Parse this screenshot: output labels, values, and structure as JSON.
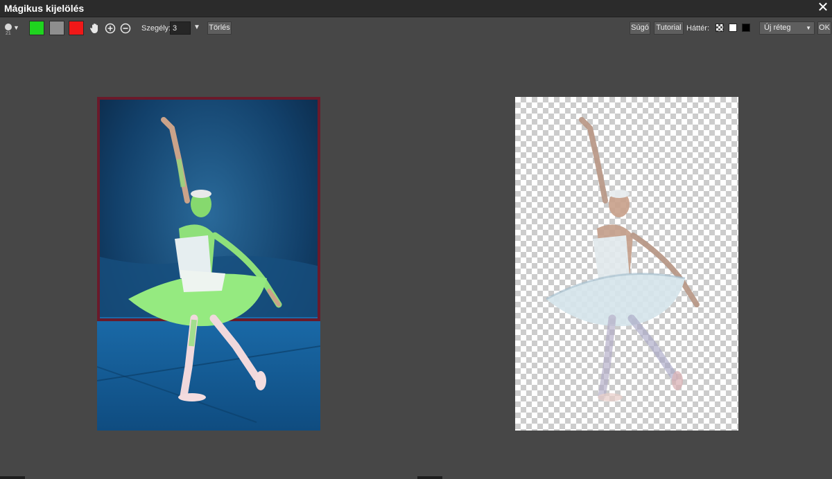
{
  "window": {
    "title": "Mágikus kijelölés",
    "close_glyph": "✕"
  },
  "toolbar": {
    "brush_size": "21",
    "brush_icon": "brush-dot-icon",
    "colors": {
      "keep": "#1fd41f",
      "neutral": "#8e8e8e",
      "remove": "#f01818"
    },
    "border_label": "Szegély:",
    "border_value": "3",
    "clear_label": "Törlés",
    "help_label": "Súgó",
    "tutorial_label": "Tutorial",
    "background_label": "Háttér:",
    "layer_select_value": "Új réteg",
    "ok_label": "OK"
  },
  "icons": [
    "hand-icon",
    "zoom-in-icon",
    "zoom-out-icon",
    "dropdown-arrow-icon",
    "close-icon"
  ],
  "canvas": {
    "left_image": "ballerina-photo-with-green-selection-mask",
    "right_image": "ballerina-cutout-on-transparent-checkerboard"
  }
}
